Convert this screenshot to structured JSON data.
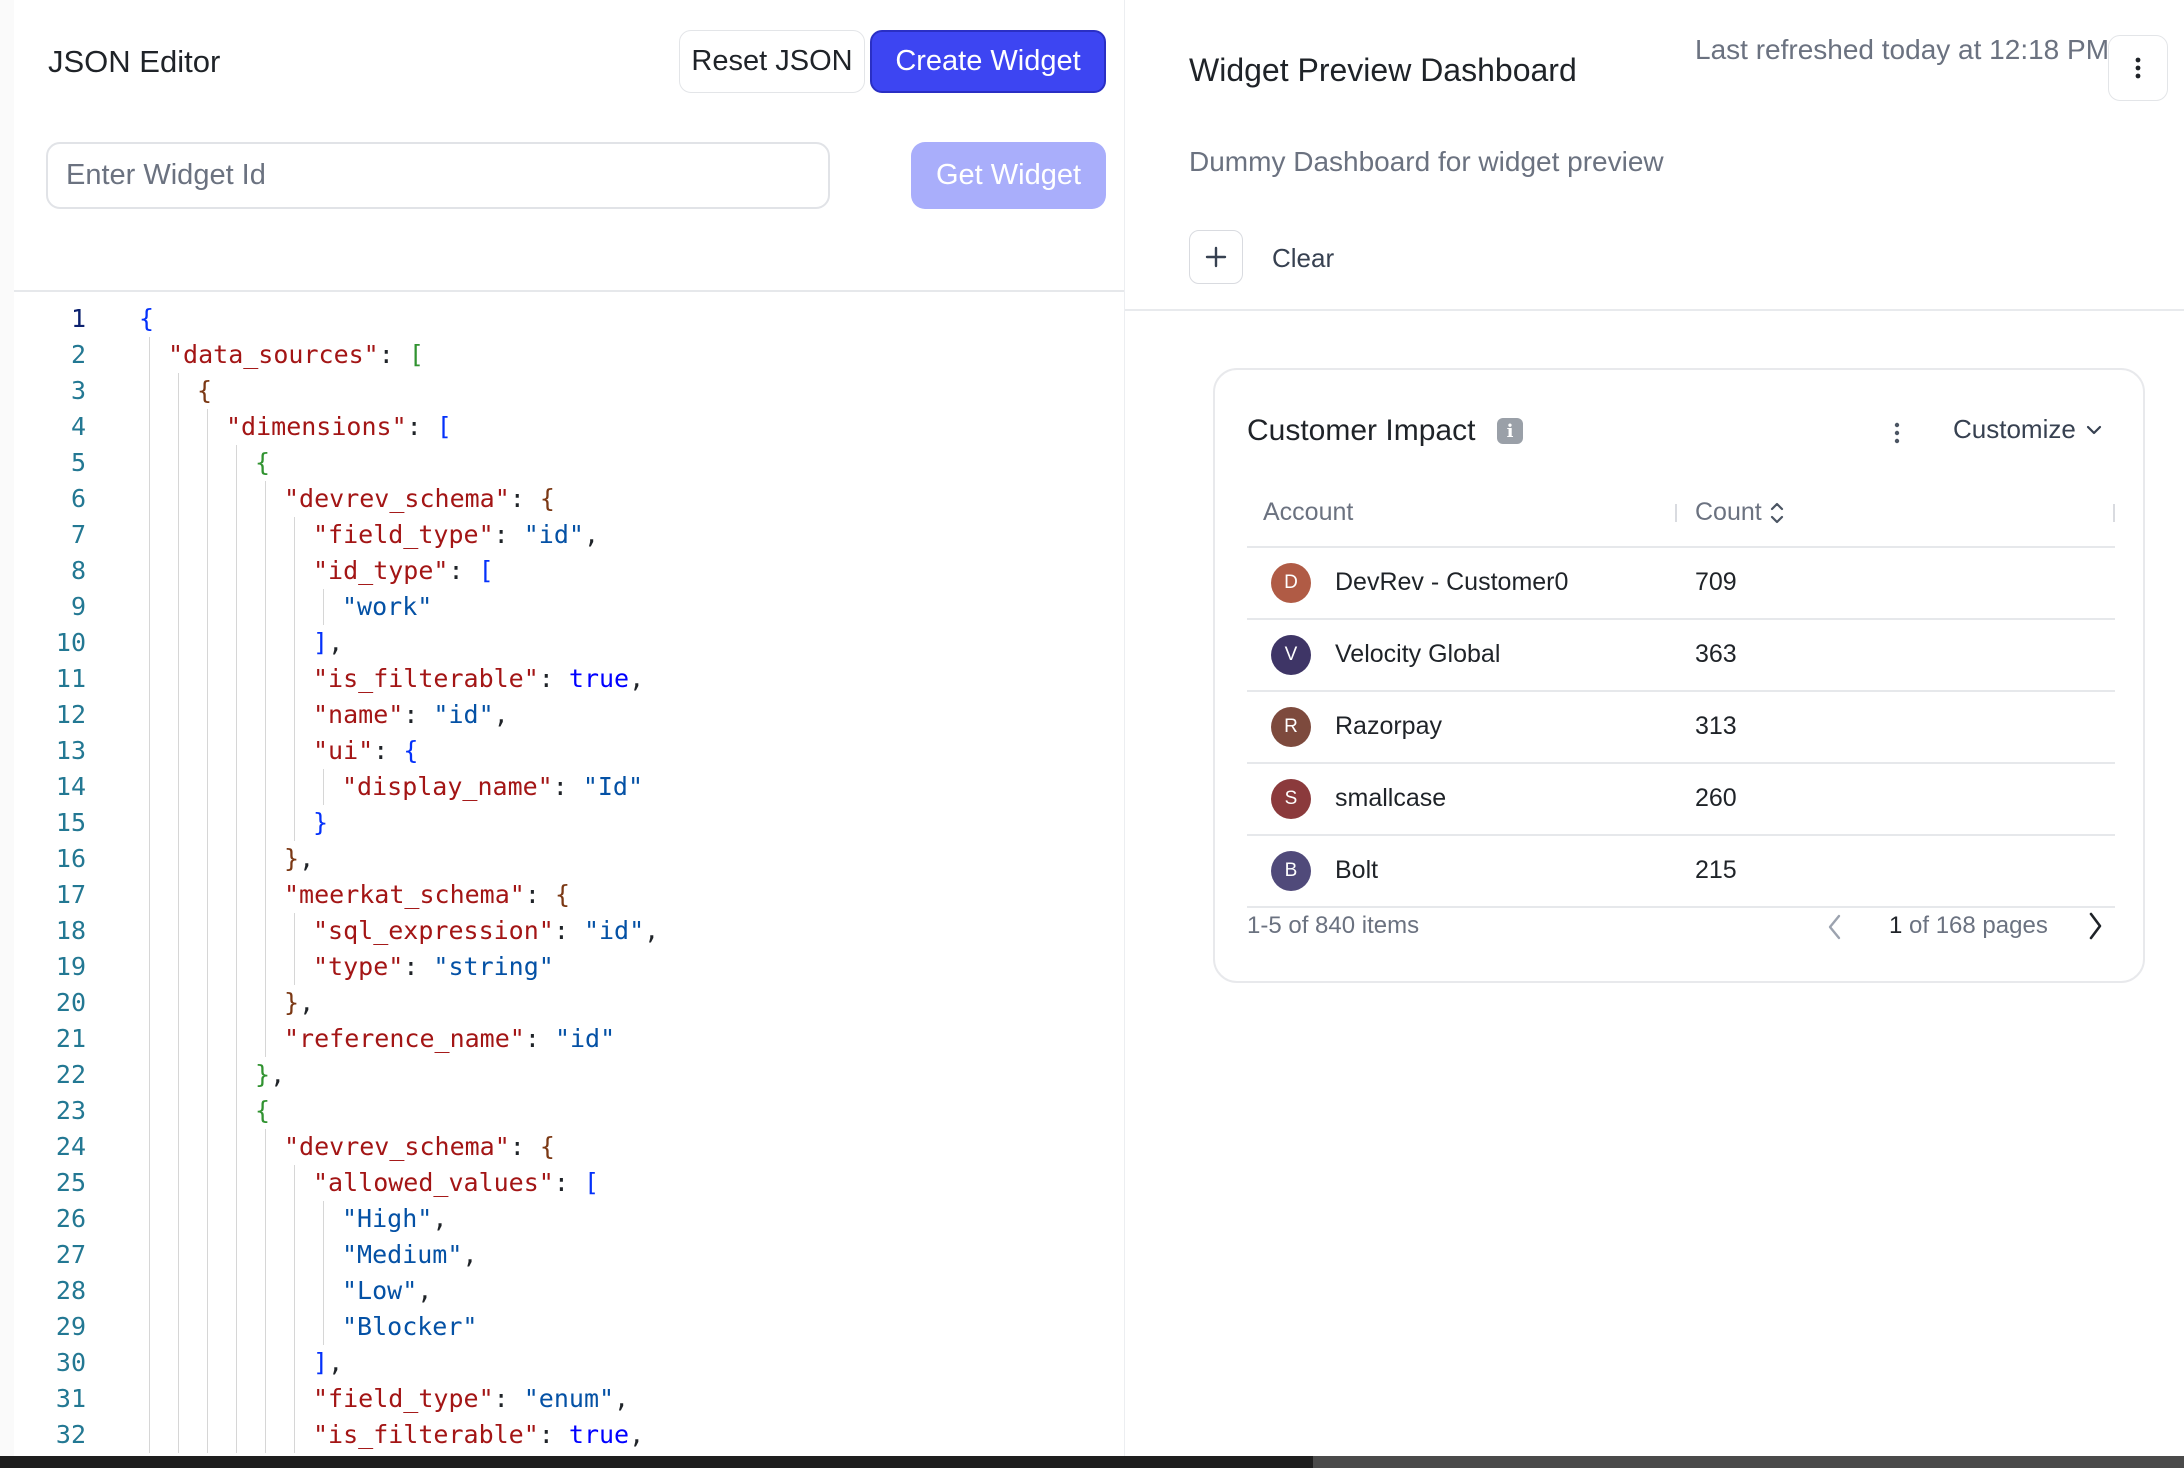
{
  "editor": {
    "title": "JSON Editor",
    "reset_label": "Reset JSON",
    "create_label": "Create Widget",
    "widget_id_placeholder": "Enter Widget Id",
    "get_label": "Get Widget",
    "active_line": 1,
    "lines": [
      {
        "n": "1",
        "d": 0,
        "t": [
          [
            "{",
            "b1"
          ]
        ]
      },
      {
        "n": "2",
        "d": 1,
        "t": [
          [
            "\"data_sources\"",
            "key"
          ],
          [
            ": ",
            "pn"
          ],
          [
            "[",
            "b2"
          ]
        ]
      },
      {
        "n": "3",
        "d": 2,
        "t": [
          [
            "{",
            "b3"
          ]
        ]
      },
      {
        "n": "4",
        "d": 3,
        "t": [
          [
            "\"dimensions\"",
            "key"
          ],
          [
            ": ",
            "pn"
          ],
          [
            "[",
            "b1"
          ]
        ]
      },
      {
        "n": "5",
        "d": 4,
        "t": [
          [
            "{",
            "b2"
          ]
        ]
      },
      {
        "n": "6",
        "d": 5,
        "t": [
          [
            "\"devrev_schema\"",
            "key"
          ],
          [
            ": ",
            "pn"
          ],
          [
            "{",
            "b3"
          ]
        ]
      },
      {
        "n": "7",
        "d": 6,
        "t": [
          [
            "\"field_type\"",
            "key"
          ],
          [
            ": ",
            "pn"
          ],
          [
            "\"id\"",
            "str"
          ],
          [
            ",",
            "pn"
          ]
        ]
      },
      {
        "n": "8",
        "d": 6,
        "t": [
          [
            "\"id_type\"",
            "key"
          ],
          [
            ": ",
            "pn"
          ],
          [
            "[",
            "b1"
          ]
        ]
      },
      {
        "n": "9",
        "d": 7,
        "t": [
          [
            "\"work\"",
            "str"
          ]
        ]
      },
      {
        "n": "10",
        "d": 6,
        "t": [
          [
            "]",
            "b1"
          ],
          [
            ",",
            "pn"
          ]
        ]
      },
      {
        "n": "11",
        "d": 6,
        "t": [
          [
            "\"is_filterable\"",
            "key"
          ],
          [
            ": ",
            "pn"
          ],
          [
            "true",
            "kw"
          ],
          [
            ",",
            "pn"
          ]
        ]
      },
      {
        "n": "12",
        "d": 6,
        "t": [
          [
            "\"name\"",
            "key"
          ],
          [
            ": ",
            "pn"
          ],
          [
            "\"id\"",
            "str"
          ],
          [
            ",",
            "pn"
          ]
        ]
      },
      {
        "n": "13",
        "d": 6,
        "t": [
          [
            "\"ui\"",
            "key"
          ],
          [
            ": ",
            "pn"
          ],
          [
            "{",
            "b1"
          ]
        ]
      },
      {
        "n": "14",
        "d": 7,
        "t": [
          [
            "\"display_name\"",
            "key"
          ],
          [
            ": ",
            "pn"
          ],
          [
            "\"Id\"",
            "str"
          ]
        ]
      },
      {
        "n": "15",
        "d": 6,
        "t": [
          [
            "}",
            "b1"
          ]
        ]
      },
      {
        "n": "16",
        "d": 5,
        "t": [
          [
            "}",
            "b3"
          ],
          [
            ",",
            "pn"
          ]
        ]
      },
      {
        "n": "17",
        "d": 5,
        "t": [
          [
            "\"meerkat_schema\"",
            "key"
          ],
          [
            ": ",
            "pn"
          ],
          [
            "{",
            "b3"
          ]
        ]
      },
      {
        "n": "18",
        "d": 6,
        "t": [
          [
            "\"sql_expression\"",
            "key"
          ],
          [
            ": ",
            "pn"
          ],
          [
            "\"id\"",
            "str"
          ],
          [
            ",",
            "pn"
          ]
        ]
      },
      {
        "n": "19",
        "d": 6,
        "t": [
          [
            "\"type\"",
            "key"
          ],
          [
            ": ",
            "pn"
          ],
          [
            "\"string\"",
            "str"
          ]
        ]
      },
      {
        "n": "20",
        "d": 5,
        "t": [
          [
            "}",
            "b3"
          ],
          [
            ",",
            "pn"
          ]
        ]
      },
      {
        "n": "21",
        "d": 5,
        "t": [
          [
            "\"reference_name\"",
            "key"
          ],
          [
            ": ",
            "pn"
          ],
          [
            "\"id\"",
            "str"
          ]
        ]
      },
      {
        "n": "22",
        "d": 4,
        "t": [
          [
            "}",
            "b2"
          ],
          [
            ",",
            "pn"
          ]
        ]
      },
      {
        "n": "23",
        "d": 4,
        "t": [
          [
            "{",
            "b2"
          ]
        ]
      },
      {
        "n": "24",
        "d": 5,
        "t": [
          [
            "\"devrev_schema\"",
            "key"
          ],
          [
            ": ",
            "pn"
          ],
          [
            "{",
            "b3"
          ]
        ]
      },
      {
        "n": "25",
        "d": 6,
        "t": [
          [
            "\"allowed_values\"",
            "key"
          ],
          [
            ": ",
            "pn"
          ],
          [
            "[",
            "b1"
          ]
        ]
      },
      {
        "n": "26",
        "d": 7,
        "t": [
          [
            "\"High\"",
            "str"
          ],
          [
            ",",
            "pn"
          ]
        ]
      },
      {
        "n": "27",
        "d": 7,
        "t": [
          [
            "\"Medium\"",
            "str"
          ],
          [
            ",",
            "pn"
          ]
        ]
      },
      {
        "n": "28",
        "d": 7,
        "t": [
          [
            "\"Low\"",
            "str"
          ],
          [
            ",",
            "pn"
          ]
        ]
      },
      {
        "n": "29",
        "d": 7,
        "t": [
          [
            "\"Blocker\"",
            "str"
          ]
        ]
      },
      {
        "n": "30",
        "d": 6,
        "t": [
          [
            "]",
            "b1"
          ],
          [
            ",",
            "pn"
          ]
        ]
      },
      {
        "n": "31",
        "d": 6,
        "t": [
          [
            "\"field_type\"",
            "key"
          ],
          [
            ": ",
            "pn"
          ],
          [
            "\"enum\"",
            "str"
          ],
          [
            ",",
            "pn"
          ]
        ]
      },
      {
        "n": "32",
        "d": 6,
        "t": [
          [
            "\"is_filterable\"",
            "key"
          ],
          [
            ": ",
            "pn"
          ],
          [
            "true",
            "kw"
          ],
          [
            ",",
            "pn"
          ]
        ]
      }
    ]
  },
  "dashboard": {
    "title": "Widget Preview Dashboard",
    "last_refreshed": "Last refreshed today at 12:18 PM",
    "description": "Dummy Dashboard for widget preview",
    "clear_label": "Clear",
    "icons": {
      "menu": "vertical-dots-icon",
      "add": "plus-icon"
    }
  },
  "widget": {
    "title": "Customer Impact",
    "info_icon": "i",
    "customize_label": "Customize",
    "columns": [
      "Account",
      "Count"
    ],
    "rows": [
      {
        "initial": "D",
        "account": "DevRev - Customer0",
        "count": "709",
        "color": "#b05b45"
      },
      {
        "initial": "V",
        "account": "Velocity Global",
        "count": "363",
        "color": "#3e3566"
      },
      {
        "initial": "R",
        "account": "Razorpay",
        "count": "313",
        "color": "#7d4a3d"
      },
      {
        "initial": "S",
        "account": "smallcase",
        "count": "260",
        "color": "#8b3a3c"
      },
      {
        "initial": "B",
        "account": "Bolt",
        "count": "215",
        "color": "#504a7a"
      }
    ],
    "items_text": "1-5 of 840 items",
    "page_current": "1",
    "page_suffix": " of 168 pages"
  },
  "colors": {
    "primary": "#3d45f2",
    "primary_disabled": "#a9aefb"
  }
}
